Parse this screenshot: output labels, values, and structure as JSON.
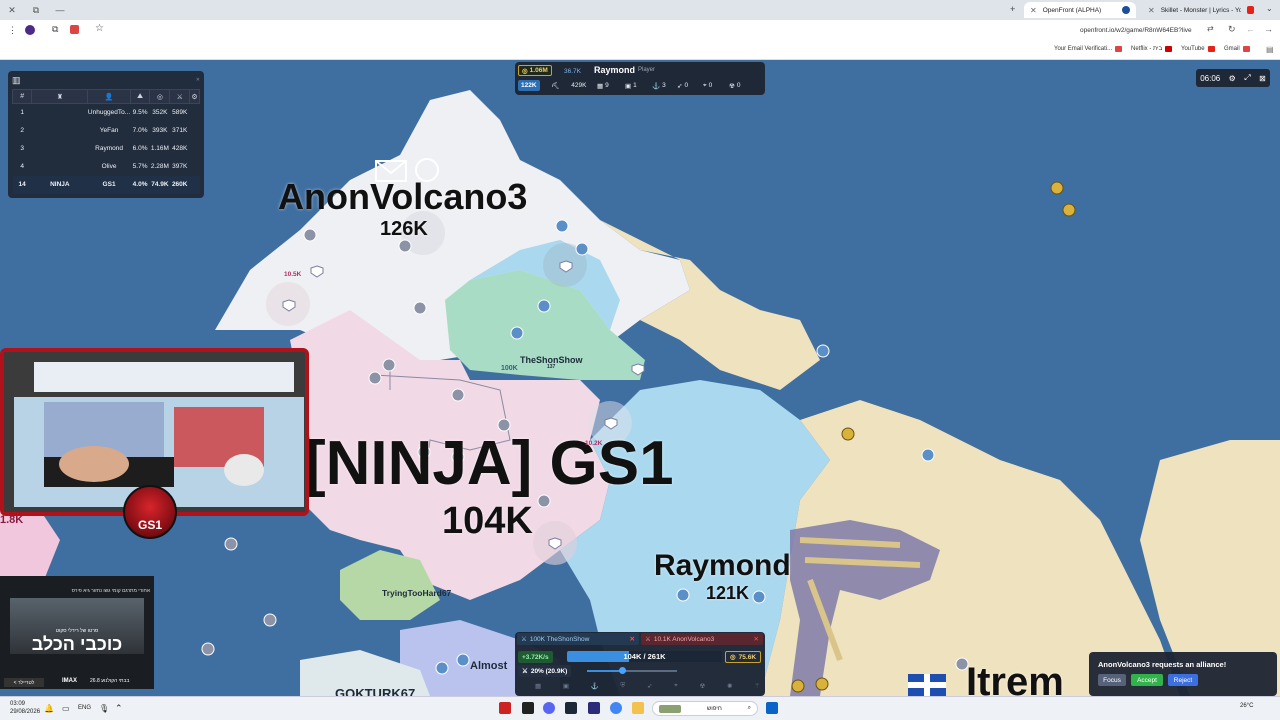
{
  "browser": {
    "tabs": [
      {
        "label": "OpenFront (ALPHA)",
        "active": true
      },
      {
        "label": "Skillet - Monster | Lyrics - YouT",
        "active": false
      }
    ],
    "url": "openfront.io/w2/game/R8nW64EB?live",
    "bookmarks": [
      "Your Email Verificati...",
      "Netflix - בית",
      "YouTube",
      "Gmail"
    ]
  },
  "leaderboard": {
    "rows": [
      {
        "rank": "1",
        "clan": "",
        "name": "UnhuggedTo...",
        "percent": "9.5%",
        "gold": "352K",
        "troops": "589K"
      },
      {
        "rank": "2",
        "clan": "",
        "name": "YeFan",
        "percent": "7.0%",
        "gold": "393K",
        "troops": "371K"
      },
      {
        "rank": "3",
        "clan": "",
        "name": "Raymond",
        "percent": "6.0%",
        "gold": "1.16M",
        "troops": "428K"
      },
      {
        "rank": "4",
        "clan": "",
        "name": "Olive",
        "percent": "5.7%",
        "gold": "2.28M",
        "troops": "397K"
      },
      {
        "rank": "14",
        "clan": "NINJA",
        "name": "GS1",
        "percent": "4.0%",
        "gold": "74.9K",
        "troops": "260K"
      }
    ]
  },
  "player_panel": {
    "gold": "1.06M",
    "troops_small": "36.7K",
    "name": "Raymond",
    "role": "Player",
    "troops": "122K",
    "workers": "429K",
    "cities": "9",
    "ports": "1",
    "warships": "3",
    "missiles": "0",
    "sams": "0",
    "nukes": "0"
  },
  "timer": "06:06",
  "map_labels": {
    "anon_name": "AnonVolcano3",
    "anon_troops": "126K",
    "ninja_name": "[NINJA] GS1",
    "ninja_troops": "104K",
    "raymond_name": "Raymond",
    "raymond_troops": "121K",
    "shonshow_name": "TheShonShow",
    "shonshow_troops": "100K",
    "shonshow_sub": "137",
    "trying_name": "TryingTooHard67",
    "almost_name": "Almost",
    "gokturk_name": "GOKTURK67",
    "itrem_name": "Itrem",
    "left_partial": "1.8K",
    "small_1": "10.5K",
    "small_2": "10.2K"
  },
  "webcam": {
    "logo_text": "GS1"
  },
  "ad": {
    "title": "כוכבי הכלב",
    "subtitle": "סרטו של רידלי סקוט",
    "credits": "אחורי  מתרגם קומי  גשו נחזור  גיא פירס",
    "imax": "IMAX",
    "date": "26.8 בבתי הקולנוע",
    "cta": "< לטריילר"
  },
  "attack_panel": {
    "outgoing_label": "100K TheShonShow",
    "incoming_label": "10.1K AnonVolcano3",
    "rate": "+3.72K/s",
    "troop_ratio": "104K / 261K",
    "gold": "75.6K",
    "attack_ratio": "20% (20.9K)"
  },
  "alliance": {
    "message": "AnonVolcano3 requests an alliance!",
    "focus": "Focus",
    "accept": "Accept",
    "reject": "Reject"
  },
  "taskbar": {
    "time": "03:09",
    "date": "29/08/2026",
    "lang": "ENG",
    "search": "חיפוש",
    "weather": "26°C"
  },
  "colors": {
    "ocean": "#3f6ea0",
    "ninja_territory": "#f1d9e6",
    "anon_territory": "#eef0f4",
    "raymond_territory": "#a9d8ef",
    "shonshow_territory": "#a9dcc4",
    "tan_land": "#efe2bf",
    "panel_bg": "#1c2432",
    "accept_green": "#32b24a",
    "reject_blue": "#3c6fe0"
  }
}
